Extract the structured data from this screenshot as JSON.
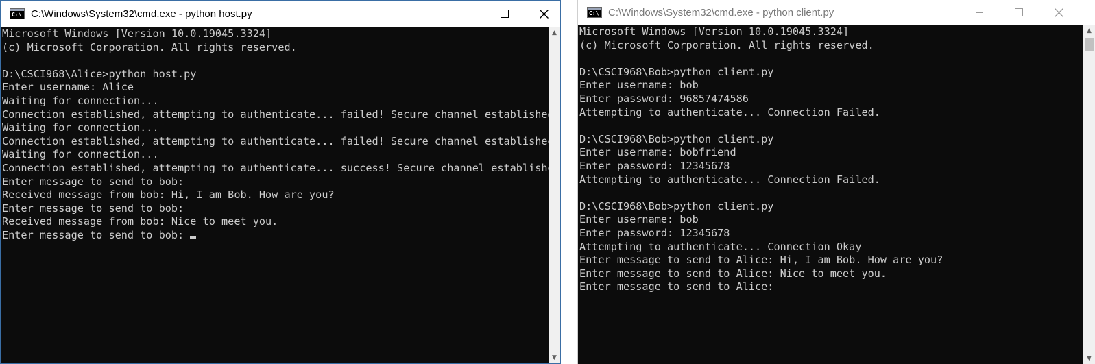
{
  "left_window": {
    "title": "C:\\Windows\\System32\\cmd.exe - python  host.py",
    "icon": "cmd-icon",
    "lines": [
      "Microsoft Windows [Version 10.0.19045.3324]",
      "(c) Microsoft Corporation. All rights reserved.",
      "",
      "D:\\CSCI968\\Alice>python host.py",
      "Enter username: Alice",
      "Waiting for connection...",
      "Connection established, attempting to authenticate... failed! Secure channel established",
      "Waiting for connection...",
      "Connection established, attempting to authenticate... failed! Secure channel established",
      "Waiting for connection...",
      "Connection established, attempting to authenticate... success! Secure channel established",
      "Enter message to send to bob:",
      "Received message from bob: Hi, I am Bob. How are you?",
      "Enter message to send to bob:",
      "Received message from bob: Nice to meet you.",
      "Enter message to send to bob: "
    ]
  },
  "right_window": {
    "title": "C:\\Windows\\System32\\cmd.exe - python  client.py",
    "icon": "cmd-icon",
    "lines": [
      "Microsoft Windows [Version 10.0.19045.3324]",
      "(c) Microsoft Corporation. All rights reserved.",
      "",
      "D:\\CSCI968\\Bob>python client.py",
      "Enter username: bob",
      "Enter password: 96857474586",
      "Attempting to authenticate... Connection Failed.",
      "",
      "D:\\CSCI968\\Bob>python client.py",
      "Enter username: bobfriend",
      "Enter password: 12345678",
      "Attempting to authenticate... Connection Failed.",
      "",
      "D:\\CSCI968\\Bob>python client.py",
      "Enter username: bob",
      "Enter password: 12345678",
      "Attempting to authenticate... Connection Okay",
      "Enter message to send to Alice: Hi, I am Bob. How are you?",
      "Enter message to send to Alice: Nice to meet you.",
      "Enter message to send to Alice:"
    ]
  },
  "colors": {
    "console_bg": "#0c0c0c",
    "console_text": "#cccccc",
    "titlebar_bg": "#ffffff"
  }
}
